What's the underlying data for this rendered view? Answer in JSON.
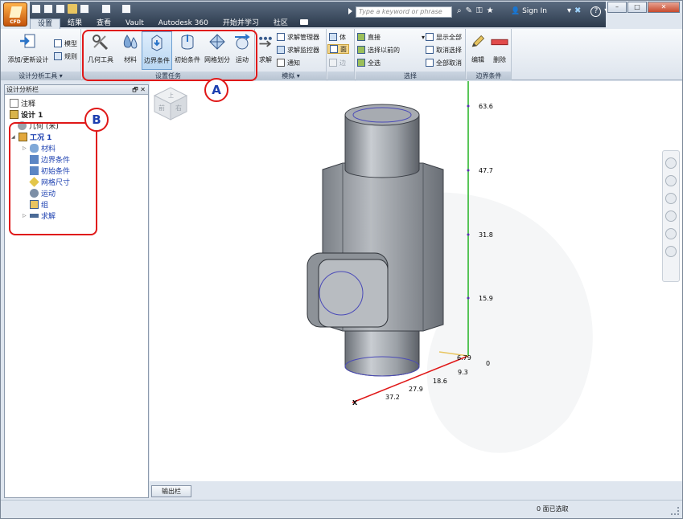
{
  "quick_access": {
    "search_placeholder": "Type a keyword or phrase",
    "sign_in": "Sign In",
    "help": "?"
  },
  "window": {
    "min": "–",
    "max": "□",
    "close": "✕"
  },
  "app": {
    "abbrev": "CFD"
  },
  "tabs": [
    {
      "label": "设置"
    },
    {
      "label": "结果"
    },
    {
      "label": "查看"
    },
    {
      "label": "Vault"
    },
    {
      "label": "Autodesk 360"
    },
    {
      "label": "开始并学习"
    },
    {
      "label": "社区"
    }
  ],
  "ribbon": {
    "design_tools": {
      "label": "设计分析工具",
      "add_update": "添加/更新设计",
      "model": "模型",
      "rules": "规则"
    },
    "setup": {
      "label": "设置任务",
      "geometry_tools": "几何工具",
      "materials": "材料",
      "boundary_conditions": "边界条件",
      "initial_conditions": "初始条件",
      "mesh_size": "网格划分",
      "motion": "运动"
    },
    "simulation": {
      "label": "模拟",
      "solve": "求解",
      "solve_manager": "求解管理器",
      "solve_monitor": "求解监控器",
      "notify": "通知"
    },
    "selection_type": {
      "volume": "体",
      "surface": "面",
      "edge": "边"
    },
    "selection": {
      "label": "选择",
      "mode": "直接",
      "select_previous": "选择以前的",
      "select_all": "全选",
      "show_all": "显示全部",
      "deselect": "取消选择",
      "deselect_all": "全部取消"
    },
    "bc_panel": {
      "label": "边界条件",
      "edit": "编辑",
      "delete": "删除"
    }
  },
  "design_panel": {
    "title": "设计分析栏",
    "tree": {
      "notes": "注释",
      "design": "设计 1",
      "geometry": "几何 (米)",
      "scenario": "工况 1",
      "materials": "材料",
      "boundary_conditions": "边界条件",
      "initial_conditions": "初始条件",
      "mesh_size": "网格尺寸",
      "motion": "运动",
      "groups": "组",
      "solve": "求解"
    }
  },
  "axes": {
    "y_ticks": [
      "63.6",
      "47.7",
      "31.8",
      "15.9",
      "0"
    ],
    "x_ticks": [
      "9.3",
      "18.6",
      "27.9",
      "37.2"
    ],
    "z_tick": "6.79",
    "x_label": "X"
  },
  "viewcube": {
    "front": "前",
    "right": "右",
    "top": "上"
  },
  "callouts": {
    "a": "A",
    "b": "B"
  },
  "bottom": {
    "output_button": "输出栏",
    "status": "0 面已选取"
  },
  "colors": {
    "callout": "#e01818",
    "label_blue": "#1b3fb0",
    "y_axis": "#22b322",
    "x_axis": "#e01818"
  }
}
